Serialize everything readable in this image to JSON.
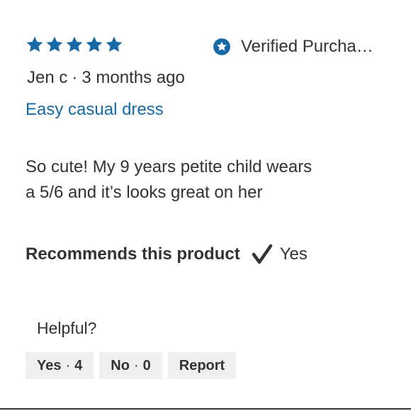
{
  "review": {
    "rating": 5,
    "rating_max": 5,
    "star_color": "#1769a6",
    "verified_label": "Verified Purcha…",
    "author": "Jen c",
    "separator": "·",
    "age": "3 months ago",
    "title": "Easy casual dress",
    "body_line1": "So cute! My 9 years petite child wears",
    "body_line2": "a 5/6 and it’s looks great on her",
    "recommend_label": "Recommends this product",
    "recommend_value": "Yes",
    "helpful_label": "Helpful?",
    "votes": {
      "yes_label": "Yes",
      "yes_count": "4",
      "no_label": "No",
      "no_count": "0",
      "report_label": "Report"
    }
  },
  "icons": {
    "star": "star-icon",
    "verified": "verified-badge-icon",
    "check": "checkmark-icon"
  }
}
